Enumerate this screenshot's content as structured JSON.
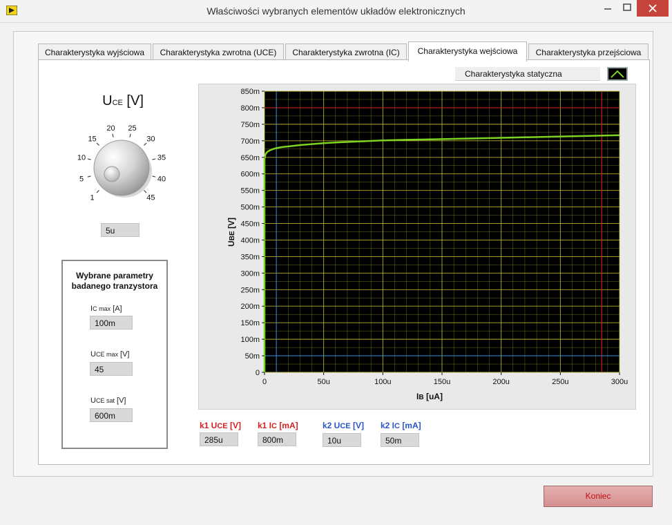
{
  "window": {
    "title": "Właściwości wybranych elementów układów elektronicznych",
    "icon": "labview-run-icon",
    "controls": [
      "minimize-icon",
      "maximize-icon",
      "close-icon"
    ]
  },
  "tabs": [
    {
      "label": "Charakterystyka wyjściowa",
      "active": false
    },
    {
      "label": "Charakterystyka zwrotna (UCE)",
      "active": false
    },
    {
      "label": "Charakterystyka zwrotna (IC)",
      "active": false
    },
    {
      "label": "Charakterystyka wejściowa",
      "active": true
    },
    {
      "label": "Charakterystyka przejściowa",
      "active": false
    }
  ],
  "mode_selector": {
    "label": "Charakterystyka statyczna",
    "icon": "chevron-up-icon"
  },
  "knob": {
    "title_main": "U",
    "title_sub": "CE",
    "title_unit": "[V]",
    "scale_labels": [
      "1",
      "5",
      "10",
      "15",
      "20",
      "25",
      "30",
      "35",
      "40",
      "45"
    ],
    "value": "5u"
  },
  "params": {
    "title": "Wybrane parametry badanego tranzystora",
    "items": [
      {
        "label_main": "I",
        "label_sub": "C max",
        "label_unit": "[A]",
        "value": "100m"
      },
      {
        "label_main": "U",
        "label_sub": "CE max",
        "label_unit": "[V]",
        "value": "45"
      },
      {
        "label_main": "U",
        "label_sub": "CE sat",
        "label_unit": "[V]",
        "value": "600m"
      }
    ]
  },
  "cursors": [
    {
      "label_main": "k1 U",
      "label_sub": "CE",
      "label_unit": "[V]",
      "value": "285u",
      "color": "#d42020"
    },
    {
      "label_main": "k1 I",
      "label_sub": "C",
      "label_unit": "[mA]",
      "value": "800m",
      "color": "#d42020"
    },
    {
      "label_main": "k2 U",
      "label_sub": "CE",
      "label_unit": "[V]",
      "value": "10u",
      "color": "#2a55c8"
    },
    {
      "label_main": "k2 I",
      "label_sub": "C",
      "label_unit": "[mA]",
      "value": "50m",
      "color": "#2a55c8"
    }
  ],
  "buttons": {
    "quit": "Koniec"
  },
  "chart_data": {
    "type": "line",
    "xlabel_main": "I",
    "xlabel_sub": "B",
    "xlabel_unit": "[uA]",
    "ylabel_main": "U",
    "ylabel_sub": "BE",
    "ylabel_unit": "[V]",
    "xlim": [
      0,
      300
    ],
    "ylim": [
      0,
      850
    ],
    "x_ticks": [
      "0",
      "50u",
      "100u",
      "150u",
      "200u",
      "250u",
      "300u"
    ],
    "x_tick_values": [
      0,
      50,
      100,
      150,
      200,
      250,
      300
    ],
    "y_ticks": [
      "0",
      "50m",
      "100m",
      "150m",
      "200m",
      "250m",
      "300m",
      "350m",
      "400m",
      "450m",
      "500m",
      "550m",
      "600m",
      "650m",
      "700m",
      "750m",
      "800m",
      "850m"
    ],
    "y_tick_values": [
      0,
      50,
      100,
      150,
      200,
      250,
      300,
      350,
      400,
      450,
      500,
      550,
      600,
      650,
      700,
      750,
      800,
      850
    ],
    "grid": true,
    "plot_background": "#000000",
    "grid_color": "#c8c23a",
    "series": [
      {
        "color": "#7ed321",
        "x": [
          0,
          0,
          0.5,
          1,
          2,
          3,
          5,
          8,
          10,
          15,
          20,
          30,
          40,
          50,
          60,
          80,
          100,
          120,
          150,
          200,
          250,
          300
        ],
        "y": [
          0,
          645,
          655,
          660,
          665,
          668,
          672,
          676,
          678,
          681,
          683,
          687,
          690,
          693,
          695,
          698,
          701,
          703,
          705,
          709,
          713,
          717
        ]
      }
    ],
    "cursors": [
      {
        "x": 285,
        "y": 800,
        "color": "#e02020"
      },
      {
        "x": 10,
        "y": 50,
        "color": "#3a8fd8"
      }
    ]
  }
}
